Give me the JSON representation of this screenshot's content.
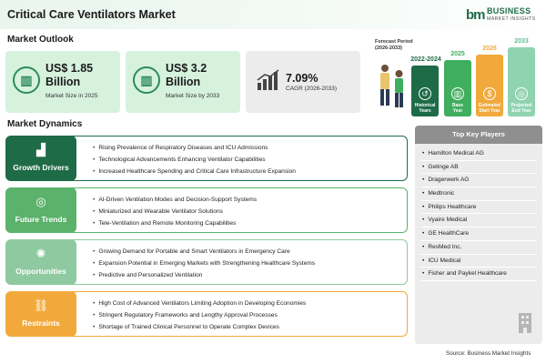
{
  "header": {
    "title": "Critical Care Ventilators Market"
  },
  "logo": {
    "mark": "bm",
    "name": "BUSINESS",
    "tagline": "MARKET INSIGHTS"
  },
  "outlook": {
    "heading": "Market Outlook",
    "kpis": [
      {
        "value": "US$ 1.85 Billion",
        "caption": "Market Size in 2025",
        "icon": "chart-icon"
      },
      {
        "value": "US$ 3.2 Billion",
        "caption": "Market Size by 2033",
        "icon": "chart-icon"
      },
      {
        "value": "7.09%",
        "caption": "CAGR (2026-2033)",
        "icon": "trend-icon"
      }
    ]
  },
  "forecast": {
    "label_line1": "Forecast Period",
    "label_line2": "(2026-2033)",
    "bars": [
      {
        "year": "2022-2024",
        "label_line1": "Historical",
        "label_line2": "Years",
        "color": "#1e6b47",
        "icon": "history-icon"
      },
      {
        "year": "2025",
        "label_line1": "Base",
        "label_line2": "Year",
        "color": "#3fae5e",
        "icon": "chart-icon"
      },
      {
        "year": "2026",
        "label_line1": "Estimated",
        "label_line2": "Start Year",
        "color": "#f2a93b",
        "icon": "dollar-chart-icon"
      },
      {
        "year": "2033",
        "label_line1": "Projected",
        "label_line2": "End Year",
        "color": "#8fd3b0",
        "icon": "target-icon"
      }
    ]
  },
  "dynamics": {
    "heading": "Market Dynamics",
    "rows": [
      {
        "title": "Growth Drivers",
        "icon": "bar-chart-icon",
        "points": [
          "Rising Prevalence of Respiratory Diseases and ICU Admissions",
          "Technological Advancements Enhancing Ventilator Capabilities",
          "Increased Healthcare Spending and Critical Care Infrastructure Expansion"
        ]
      },
      {
        "title": "Future Trends",
        "icon": "target-icon",
        "points": [
          "AI-Driven Ventilation Modes and Decision-Support Systems",
          "Miniaturized and Wearable Ventilator Solutions",
          "Tele-Ventilation and Remote Monitoring Capabilities"
        ]
      },
      {
        "title": "Opportunities",
        "icon": "lightbulb-icon",
        "points": [
          "Growing Demand for Portable and Smart Ventilators in Emergency Care",
          "Expansion Potential in Emerging Markets with Strengthening Healthcare Systems",
          "Predictive and Personalized Ventilation"
        ]
      },
      {
        "title": "Restraints",
        "icon": "restraint-icon",
        "points": [
          "High Cost of Advanced Ventilators Limiting Adoption in Developing Economies",
          "Stringent Regulatory Frameworks and Lengthy Approval Processes",
          "Shortage of Trained Clinical Personnel to Operate Complex Devices"
        ]
      }
    ]
  },
  "players": {
    "heading": "Top Key Players",
    "items": [
      "Hamilton Medical AG",
      "Getinge AB",
      "Dragerwerk AG",
      "Medtronic",
      "Philips Healthcare",
      "Vyaire Medical",
      "GE HealthCare",
      "ResMed Inc.",
      "ICU Medical",
      "Fisher and Paykel Healthcare"
    ]
  },
  "source": "Source: Business Market Insights"
}
